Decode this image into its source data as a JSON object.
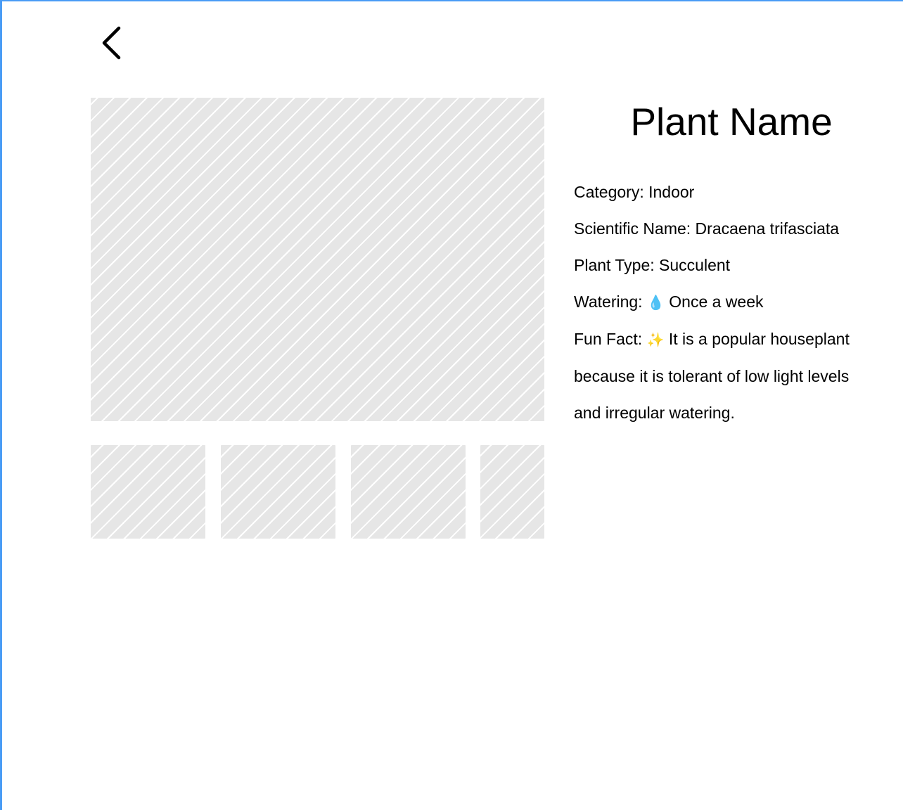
{
  "header": {
    "back_icon": "chevron-left-icon"
  },
  "gallery": {
    "main_image": "image-placeholder",
    "thumbnails": [
      "image-placeholder",
      "image-placeholder",
      "image-placeholder",
      "image-placeholder"
    ]
  },
  "plant": {
    "title": "Plant Name",
    "category": "Category: Indoor",
    "scientific_name": "Scientific Name: Dracaena trifasciata",
    "plant_type": "Plant Type: Succulent",
    "watering_label": "Watering:",
    "watering_icon": "💧",
    "watering_value": "Once a week",
    "fun_fact_label": "Fun Fact:",
    "fun_fact_icon": "✨",
    "fun_fact_line1": "It is a popular houseplant",
    "fun_fact_line2": "because it is tolerant of low light levels",
    "fun_fact_line3": "and irregular watering."
  },
  "colors": {
    "frame_border": "#4a9cf5",
    "placeholder_fill": "#e6e6e6",
    "placeholder_stripe": "#ffffff"
  }
}
